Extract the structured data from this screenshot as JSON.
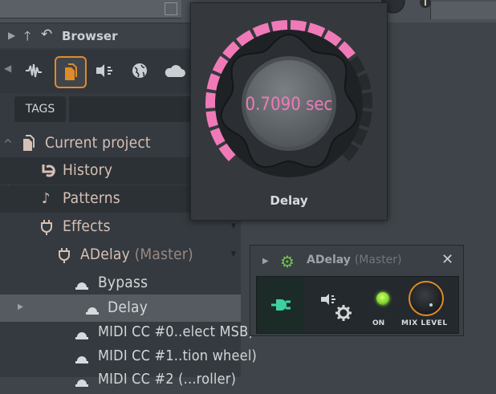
{
  "browser": {
    "title": "Browser",
    "tags_label": "TAGS",
    "toolbar_icons": [
      "all-icon",
      "current-project-icon",
      "plugin-database-icon",
      "world-icon",
      "cloud-icon"
    ],
    "tree": [
      {
        "label": "Current project",
        "icon": "document-icon"
      },
      {
        "label": "History",
        "icon": "history-icon"
      },
      {
        "label": "Patterns",
        "icon": "note-icon"
      },
      {
        "label": "Effects",
        "icon": "plug-icon"
      },
      {
        "label": "ADelay",
        "sub": "(Master)",
        "icon": "plug-icon"
      },
      {
        "label": "Bypass",
        "icon": "knob-icon"
      },
      {
        "label": "Delay",
        "icon": "knob-icon"
      },
      {
        "label": "MIDI CC #0..elect MSB)",
        "icon": "knob-icon"
      },
      {
        "label": "MIDI CC #1..tion wheel)",
        "icon": "knob-icon"
      },
      {
        "label": "MIDI CC #2 (...roller)",
        "icon": "knob-icon"
      }
    ]
  },
  "knob_popup": {
    "value": "0.7090 sec",
    "name": "Delay",
    "level": 0.709,
    "accent": "#f07ab8"
  },
  "plugin": {
    "name": "ADelay",
    "suffix": "(Master)",
    "on_label": "ON",
    "mix_label": "MIX LEVEL",
    "close_symbol": "✕",
    "accent": "#e08a2a",
    "led_color": "#7ad12a"
  }
}
